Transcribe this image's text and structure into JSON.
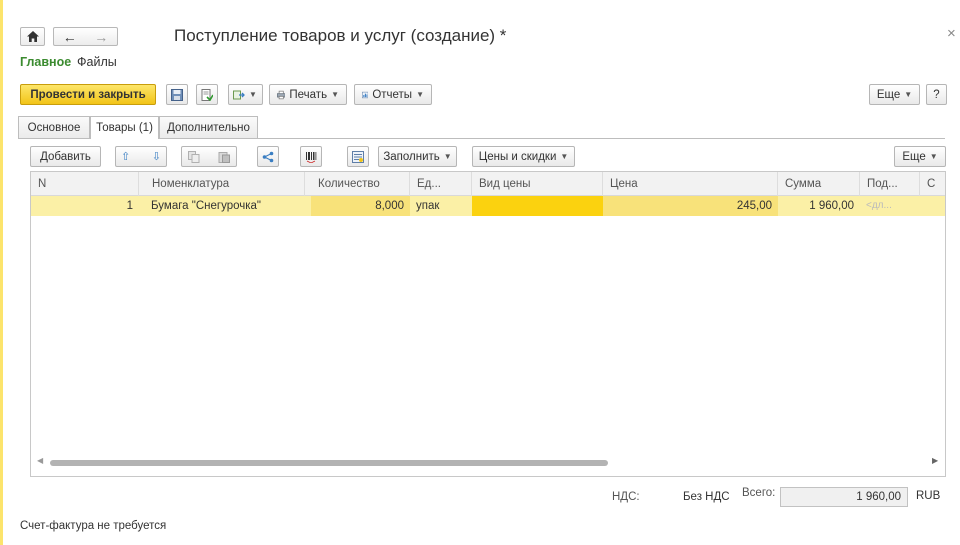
{
  "window": {
    "title": "Поступление товаров и услуг (создание) *",
    "close": "×"
  },
  "nav": {
    "home_icon": "home-icon",
    "back_icon": "arrow-left-icon",
    "forward_icon": "arrow-right-icon"
  },
  "sections": {
    "main": "Главное",
    "files": "Файлы"
  },
  "toolbar": {
    "post_close": "Провести и закрыть",
    "print": "Печать",
    "reports": "Отчеты",
    "more": "Еще",
    "help": "?"
  },
  "tabs": [
    {
      "label": "Основное"
    },
    {
      "label": "Товары (1)"
    },
    {
      "label": "Дополнительно"
    }
  ],
  "table_toolbar": {
    "add": "Добавить",
    "fill": "Заполнить",
    "prices_discounts": "Цены и скидки",
    "more": "Еще"
  },
  "table": {
    "columns": [
      "N",
      "Номенклатура",
      "Количество",
      "Ед...",
      "Вид цены",
      "Цена",
      "Сумма",
      "Под...",
      "С"
    ],
    "rows": [
      {
        "n": "1",
        "item": "Бумага \"Снегурочка\"",
        "qty": "8,000",
        "unit": "упак",
        "price_type": "",
        "price": "245,00",
        "sum": "1 960,00",
        "sub": "<дл..."
      }
    ]
  },
  "totals": {
    "vat_label": "НДС:",
    "vat_value": "Без НДС",
    "total_label": "Всего:",
    "total_value": "1 960,00",
    "currency": "RUB"
  },
  "footer": {
    "invoice_note": "Счет-фактура не требуется"
  },
  "colors": {
    "accent_yellow": "#f2c418",
    "row_highlight": "#fbf0a6",
    "cell_highlight": "#fbd20f",
    "section_green": "#3b8b2f"
  }
}
